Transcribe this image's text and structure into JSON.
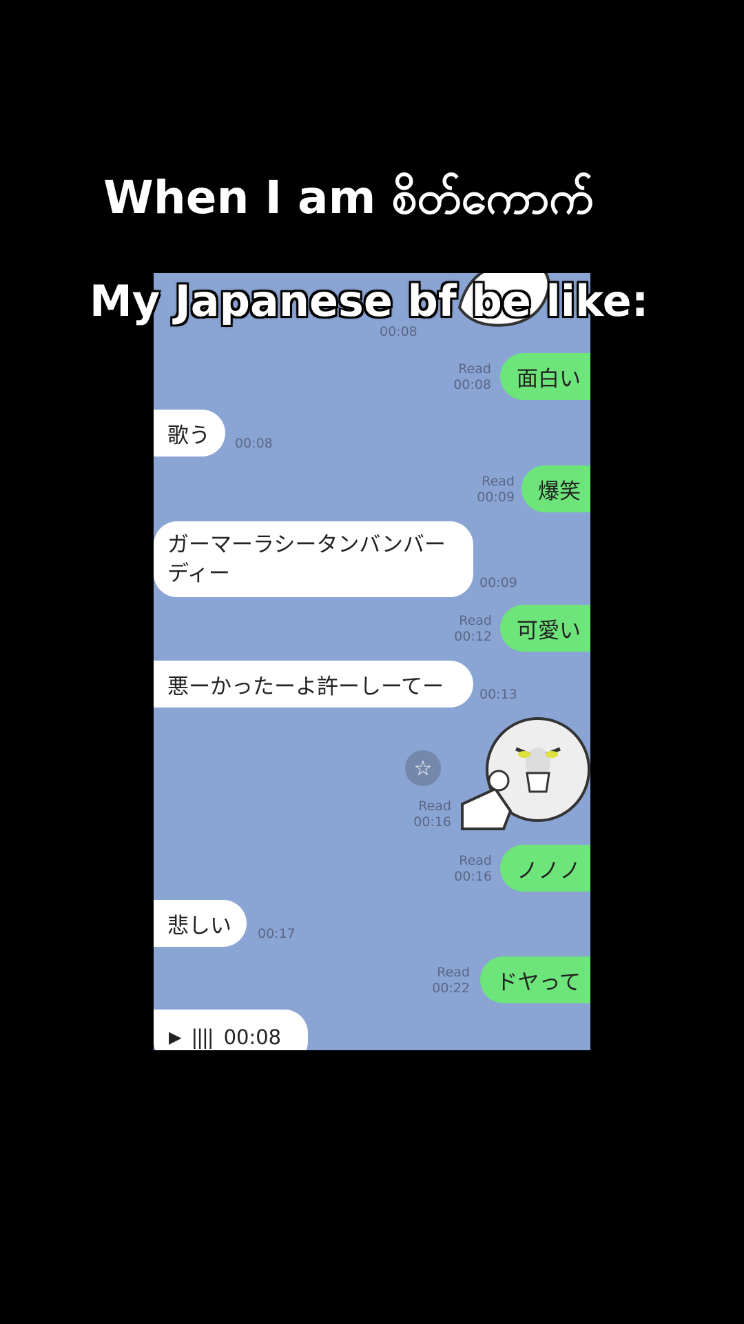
{
  "captions": {
    "line1": "When I am စိတ်ကောက်",
    "line2": "My Japanese bf be like:"
  },
  "chat": {
    "top_meta": "00:08",
    "messages": [
      {
        "dir": "out",
        "text": "面白い",
        "read": "Read",
        "time": "00:08"
      },
      {
        "dir": "in",
        "text": "歌う",
        "time": "00:08"
      },
      {
        "dir": "out",
        "text": "爆笑",
        "read": "Read",
        "time": "00:09"
      },
      {
        "dir": "in",
        "text": "ガーマーラシータンバンバーディー",
        "time": "00:09"
      },
      {
        "dir": "out",
        "text": "可愛い",
        "read": "Read",
        "time": "00:12"
      },
      {
        "dir": "in",
        "text": "悪ーかったーよ許ーしーてー",
        "time": "00:13"
      },
      {
        "dir": "out",
        "text": "",
        "sticker": "pointing-face-sticker",
        "read": "Read",
        "time": "00:16"
      },
      {
        "dir": "out",
        "text": "ノノノ",
        "read": "Read",
        "time": "00:16"
      },
      {
        "dir": "in",
        "text": "悲しい",
        "time": "00:17"
      },
      {
        "dir": "out",
        "text": "ドヤって",
        "read": "Read",
        "time": "00:22"
      }
    ],
    "voice": {
      "duration": "00:08"
    },
    "icons": {
      "star": "star-icon",
      "play": "play-icon",
      "waveform": "waveform-icon"
    },
    "colors": {
      "background": "#8aa4d4",
      "outgoing": "#6de57a",
      "incoming": "#ffffff"
    }
  }
}
